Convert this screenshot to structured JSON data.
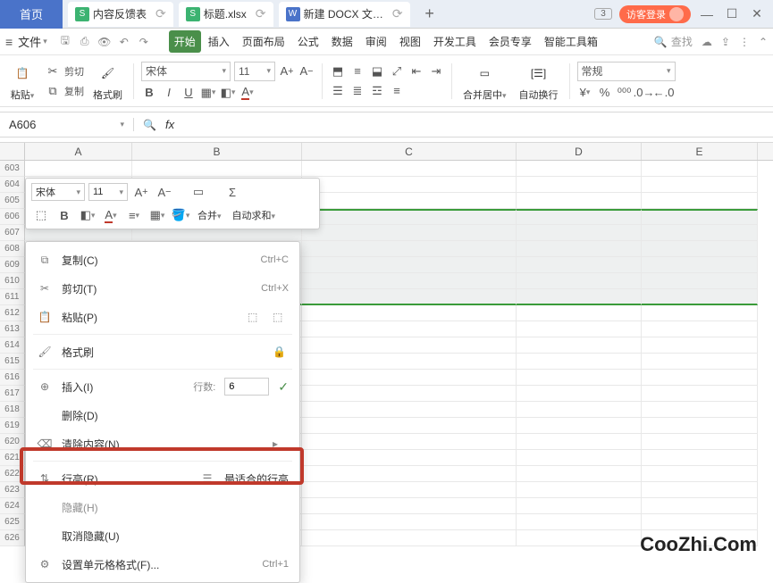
{
  "tabs": {
    "home": "首页",
    "items": [
      {
        "icon_bg": "#3cb371",
        "icon_letter": "S",
        "label": "内容反馈表"
      },
      {
        "icon_bg": "#3cb371",
        "icon_letter": "S",
        "label": "标题.xlsx",
        "active": true
      },
      {
        "icon_bg": "#4a73c9",
        "icon_letter": "W",
        "label": "新建 DOCX 文…"
      }
    ],
    "badge": "3",
    "login": "访客登录"
  },
  "menu": {
    "file": "文件",
    "tabs": [
      "开始",
      "插入",
      "页面布局",
      "公式",
      "数据",
      "审阅",
      "视图",
      "开发工具",
      "会员专享",
      "智能工具箱"
    ],
    "active_index": 0,
    "search": "查找"
  },
  "ribbon": {
    "paste": "粘贴",
    "cut": "剪切",
    "copy": "复制",
    "format_painter": "格式刷",
    "font_name": "宋体",
    "font_size": "11",
    "merge_center": "合并居中",
    "auto_wrap": "自动换行",
    "number_format": "常规"
  },
  "formula": {
    "cell_ref": "A606",
    "fx": "fx"
  },
  "columns": [
    "A",
    "B",
    "C",
    "D",
    "E"
  ],
  "row_start": 603,
  "row_count": 24,
  "mini_toolbar": {
    "font_name": "宋体",
    "font_size": "11",
    "merge": "合并",
    "autosum": "自动求和"
  },
  "context_menu": {
    "copy": {
      "label": "复制(C)",
      "shortcut": "Ctrl+C"
    },
    "cut": {
      "label": "剪切(T)",
      "shortcut": "Ctrl+X"
    },
    "paste": {
      "label": "粘贴(P)"
    },
    "format_painter": {
      "label": "格式刷"
    },
    "insert": {
      "label": "插入(I)",
      "rows_label": "行数:",
      "rows_value": "6"
    },
    "delete": {
      "label": "删除(D)"
    },
    "clear": {
      "label": "清除内容(N)"
    },
    "row_height": {
      "label": "行高(R)..."
    },
    "autofit": {
      "label": "最适合的行高"
    },
    "hide": {
      "label": "隐藏(H)"
    },
    "unhide": {
      "label": "取消隐藏(U)"
    },
    "format_cells": {
      "label": "设置单元格格式(F)...",
      "shortcut": "Ctrl+1"
    }
  },
  "watermark": "CooZhi.Com"
}
